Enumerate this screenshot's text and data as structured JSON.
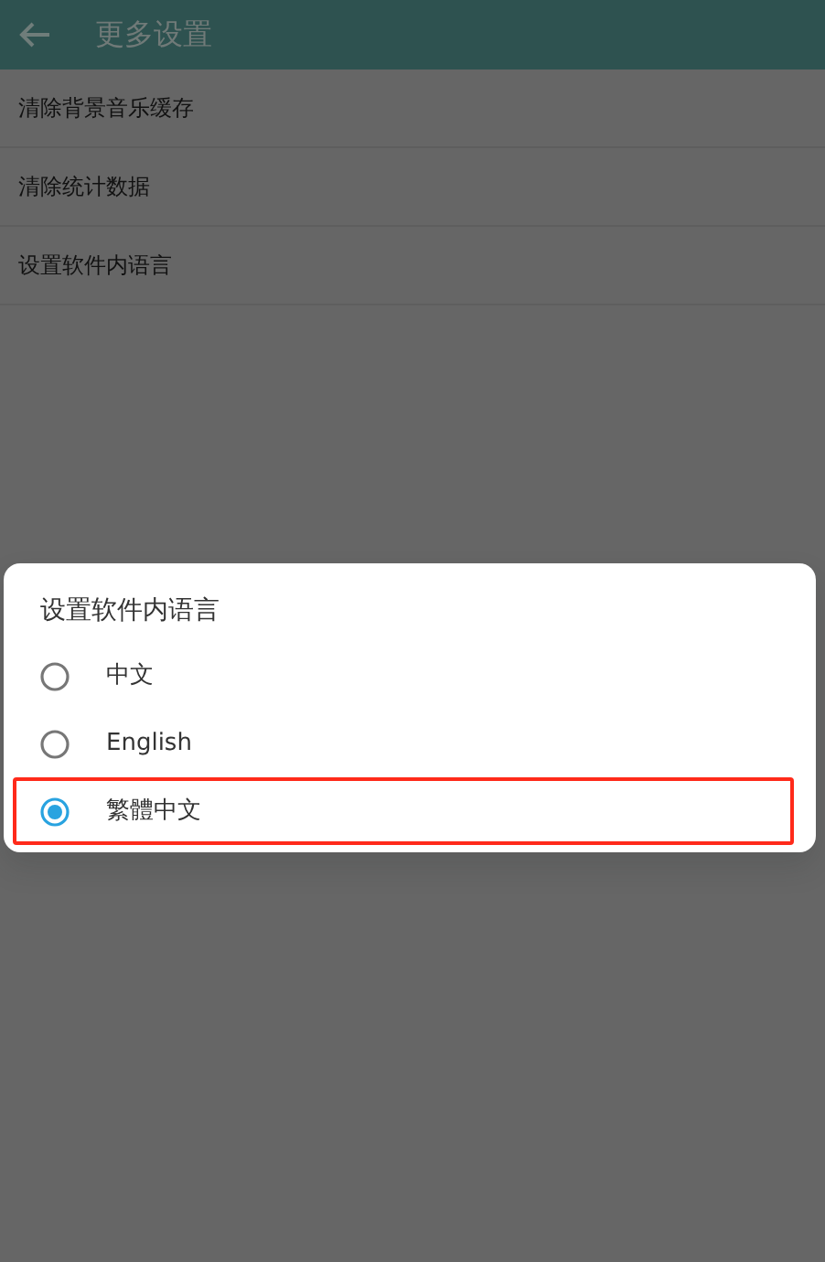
{
  "app_bar": {
    "title": "更多设置"
  },
  "settings": [
    {
      "label": "清除背景音乐缓存"
    },
    {
      "label": "清除统计数据"
    },
    {
      "label": "设置软件内语言"
    }
  ],
  "dialog": {
    "title": "设置软件内语言",
    "options": [
      {
        "label": "中文",
        "selected": false,
        "highlighted": false
      },
      {
        "label": "English",
        "selected": false,
        "highlighted": false
      },
      {
        "label": "繁體中文",
        "selected": true,
        "highlighted": true
      }
    ]
  }
}
